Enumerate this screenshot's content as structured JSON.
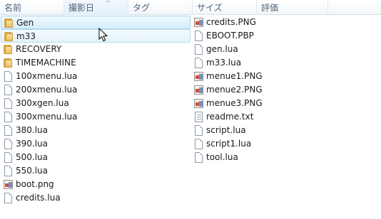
{
  "columns": [
    "名前",
    "撮影日",
    "タグ",
    "サイズ",
    "評価"
  ],
  "sort_indicator": "^",
  "files_col1": [
    {
      "name": "Gen",
      "type": "folder"
    },
    {
      "name": "m33",
      "type": "folder"
    },
    {
      "name": "RECOVERY",
      "type": "folder"
    },
    {
      "name": "TIMEMACHINE",
      "type": "folder"
    },
    {
      "name": "100xmenu.lua",
      "type": "file"
    },
    {
      "name": "200xmenu.lua",
      "type": "file"
    },
    {
      "name": "300xgen.lua",
      "type": "file"
    },
    {
      "name": "300xmenu.lua",
      "type": "file"
    },
    {
      "name": "380.lua",
      "type": "file"
    },
    {
      "name": "390.lua",
      "type": "file"
    },
    {
      "name": "500.lua",
      "type": "file"
    },
    {
      "name": "550.lua",
      "type": "file"
    },
    {
      "name": "boot.png",
      "type": "image"
    },
    {
      "name": "credits.lua",
      "type": "file"
    }
  ],
  "files_col2": [
    {
      "name": "credits.PNG",
      "type": "image"
    },
    {
      "name": "EBOOT.PBP",
      "type": "file"
    },
    {
      "name": "gen.lua",
      "type": "file"
    },
    {
      "name": "m33.lua",
      "type": "file"
    },
    {
      "name": "menue1.PNG",
      "type": "image"
    },
    {
      "name": "menue2.PNG",
      "type": "image"
    },
    {
      "name": "menue3.PNG",
      "type": "image"
    },
    {
      "name": "readme.txt",
      "type": "text"
    },
    {
      "name": "script.lua",
      "type": "file"
    },
    {
      "name": "script1.lua",
      "type": "file"
    },
    {
      "name": "tool.lua",
      "type": "file"
    }
  ]
}
